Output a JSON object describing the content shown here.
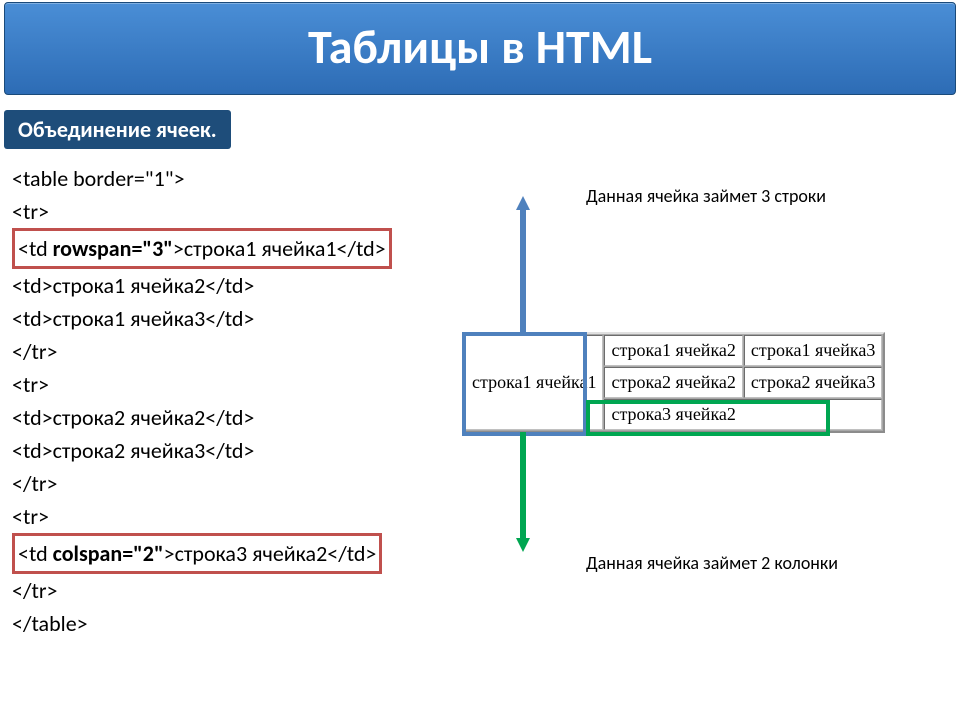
{
  "title": "Таблицы в HTML",
  "subtitle": "Объединение ячеек.",
  "code": {
    "l1": "<table border=\"1\">",
    "l2": "<tr>",
    "l3a": "<td ",
    "l3b": "rowspan=\"3\"",
    "l3c": ">строка1 ячейка1</td>",
    "l4": "<td>строка1 ячейка2</td>",
    "l5": "<td>строка1 ячейка3</td>",
    "l6": "</tr>",
    "l7": "<tr>",
    "l8": "<td>строка2 ячейка2</td>",
    "l9": "<td>строка2 ячейка3</td>",
    "l10": "</tr>",
    "l11": "<tr>",
    "l12a": "<td ",
    "l12b": "colspan=\"2\"",
    "l12c": ">строка3 ячейка2</td>",
    "l13": "</tr>",
    "l14": "</table>"
  },
  "annotations": {
    "rowspan": "Данная ячейка займет 3 строки",
    "colspan": "Данная ячейка займет 2 колонки"
  },
  "example": {
    "r1c1": "строка1 ячейка1",
    "r1c2": "строка1 ячейка2",
    "r1c3": "строка1 ячейка3",
    "r2c2": "строка2 ячейка2",
    "r2c3": "строка2 ячейка3",
    "r3c2": "строка3 ячейка2"
  }
}
